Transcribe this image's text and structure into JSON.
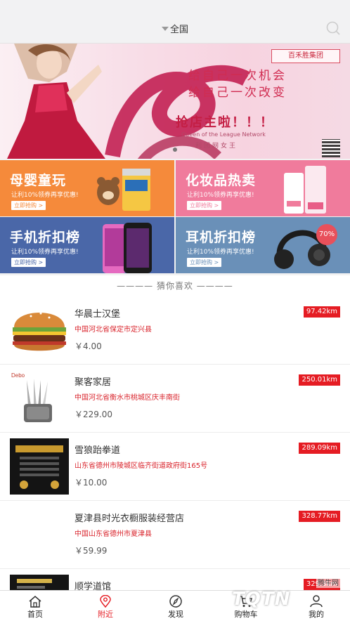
{
  "header": {
    "location": "全国"
  },
  "banner": {
    "brand": "百禾胜集团",
    "line1": "给自己一次机会",
    "line2": "给自己一次改变",
    "line3": "抢店主啦！！！",
    "line4": "Queen of the League Network",
    "line5": "利团网女王"
  },
  "promos": [
    {
      "title": "母婴童玩",
      "sub": "让利10%领券再享优惠!",
      "btn": "立即抢购 >"
    },
    {
      "title": "化妆品热卖",
      "sub": "让利10%领券再享优惠!",
      "btn": "立即抢购 >"
    },
    {
      "title": "手机折扣榜",
      "sub": "让利10%领券再享优惠!",
      "btn": "立即抢购 >"
    },
    {
      "title": "耳机折扣榜",
      "sub": "让利10%领券再享优惠!",
      "btn": "立即抢购 >",
      "badge": "70%"
    }
  ],
  "section": {
    "title": "———— 猜你喜欢 ————"
  },
  "items": [
    {
      "name": "华晨士汉堡",
      "address": "中国河北省保定市定兴县",
      "price": "￥4.00",
      "distance": "97.42km"
    },
    {
      "name": "聚客家居",
      "address": "中国河北省衡水市桃城区庆丰南街",
      "price": "￥229.00",
      "distance": "250.01km",
      "thumb_text": "Debo"
    },
    {
      "name": "雪狼跆拳道",
      "address": "山东省德州市陵城区临齐街道政府街165号",
      "price": "￥10.00",
      "distance": "289.09km"
    },
    {
      "name": "夏津县时光衣橱服装经营店",
      "address": "中国山东省德州市夏津县",
      "price": "￥59.99",
      "distance": "328.77km"
    },
    {
      "name": "顺学道馆",
      "address": "",
      "price": "",
      "distance": "329.3km"
    }
  ],
  "tabs": [
    {
      "label": "首页",
      "icon": "home-icon"
    },
    {
      "label": "附近",
      "icon": "location-pin-icon"
    },
    {
      "label": "发现",
      "icon": "compass-icon"
    },
    {
      "label": "购物车",
      "icon": "cart-icon"
    },
    {
      "label": "我的",
      "icon": "user-icon"
    }
  ],
  "watermark": {
    "brand": "TQTN",
    "site": "腾牛网"
  },
  "colors": {
    "accent": "#e51c23",
    "promo_orange": "#f58a3b",
    "promo_pink": "#f07b9c",
    "promo_blue": "#4a67a8",
    "promo_steel": "#6a90b8"
  }
}
